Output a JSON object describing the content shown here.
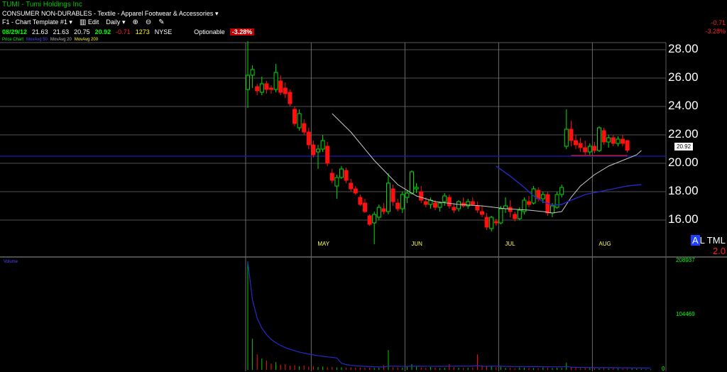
{
  "header": {
    "ticker": "TUMI",
    "company": "Tumi Holdings Inc",
    "sector": "CONSUMER NON-DURABLES",
    "industry": "Textile - Apparel Footwear & Accessories",
    "template": "F1 - Chart Template #1",
    "edit_label": "Edit",
    "period": "Daily"
  },
  "quote": {
    "date": "08/29/12",
    "open": "21.63",
    "high": "21.63",
    "low": "20.75",
    "close": "20.92",
    "change": "-0.71",
    "volume": "1273",
    "exchange": "NYSE",
    "optionable": "Optionable",
    "pct_change": "-3.28%"
  },
  "legend": {
    "price": "Price Chart",
    "ma50": "MovAvg 50",
    "ma20": "MovAvg 20",
    "ma200": "MovAvg 200"
  },
  "right_panel": {
    "change": "-0.71",
    "pct": "-3.28%",
    "last_price": "20.92",
    "indicator_a": "A",
    "indicator_text": "L TML",
    "indicator_value": "2.0"
  },
  "colors": {
    "up": "#00e000",
    "down": "#ff1010",
    "ma50": "#2828c8",
    "ma20": "#c8c8c8",
    "hline": "#1e1eb4"
  },
  "chart_data": {
    "type": "candlestick",
    "price_axis": {
      "ylim": [
        14.0,
        29.0
      ],
      "ticks": [
        "28.00",
        "26.00",
        "24.00",
        "22.00",
        "20.00",
        "18.00",
        "16.00"
      ],
      "tick_values": [
        28,
        26,
        24,
        22,
        20,
        18,
        16
      ]
    },
    "months": [
      "MAY",
      "JUN",
      "JUL",
      "AUG"
    ],
    "month_day_index": [
      14,
      34,
      54,
      74
    ],
    "num_days": 88,
    "reference_line": 20.5,
    "candles": [
      {
        "o": 25.2,
        "h": 28.6,
        "l": 23.9,
        "c": 26.2
      },
      {
        "o": 26.2,
        "h": 26.9,
        "l": 25.3,
        "c": 26.6
      },
      {
        "o": 25.4,
        "h": 25.6,
        "l": 24.8,
        "c": 25.1
      },
      {
        "o": 25.0,
        "h": 26.1,
        "l": 24.8,
        "c": 25.6
      },
      {
        "o": 25.6,
        "h": 25.8,
        "l": 24.9,
        "c": 25.2
      },
      {
        "o": 25.3,
        "h": 25.5,
        "l": 24.9,
        "c": 25.2
      },
      {
        "o": 25.2,
        "h": 27.0,
        "l": 25.0,
        "c": 26.4
      },
      {
        "o": 25.8,
        "h": 26.2,
        "l": 24.8,
        "c": 25.0
      },
      {
        "o": 25.3,
        "h": 25.7,
        "l": 24.6,
        "c": 24.9
      },
      {
        "o": 25.0,
        "h": 25.2,
        "l": 24.0,
        "c": 24.2
      },
      {
        "o": 23.8,
        "h": 24.0,
        "l": 22.6,
        "c": 22.8
      },
      {
        "o": 22.5,
        "h": 23.8,
        "l": 22.3,
        "c": 23.5
      },
      {
        "o": 22.8,
        "h": 23.1,
        "l": 22.0,
        "c": 22.2
      },
      {
        "o": 22.2,
        "h": 22.5,
        "l": 21.0,
        "c": 21.3
      },
      {
        "o": 21.3,
        "h": 21.6,
        "l": 20.4,
        "c": 20.6
      },
      {
        "o": 20.8,
        "h": 21.3,
        "l": 19.6,
        "c": 21.0
      },
      {
        "o": 21.0,
        "h": 22.0,
        "l": 20.8,
        "c": 21.6
      },
      {
        "o": 21.2,
        "h": 21.5,
        "l": 19.8,
        "c": 20.0
      },
      {
        "o": 19.3,
        "h": 19.6,
        "l": 18.6,
        "c": 18.8
      },
      {
        "o": 18.4,
        "h": 19.2,
        "l": 17.5,
        "c": 19.0
      },
      {
        "o": 19.0,
        "h": 19.8,
        "l": 18.9,
        "c": 19.6
      },
      {
        "o": 19.5,
        "h": 19.7,
        "l": 18.6,
        "c": 18.8
      },
      {
        "o": 18.6,
        "h": 18.9,
        "l": 18.0,
        "c": 18.2
      },
      {
        "o": 18.2,
        "h": 18.4,
        "l": 17.8,
        "c": 17.9
      },
      {
        "o": 17.6,
        "h": 17.8,
        "l": 17.0,
        "c": 17.1
      },
      {
        "o": 17.2,
        "h": 17.5,
        "l": 16.5,
        "c": 16.6
      },
      {
        "o": 16.3,
        "h": 16.4,
        "l": 15.6,
        "c": 15.7
      },
      {
        "o": 15.8,
        "h": 16.6,
        "l": 14.3,
        "c": 16.4
      },
      {
        "o": 16.2,
        "h": 17.1,
        "l": 16.0,
        "c": 16.9
      },
      {
        "o": 16.8,
        "h": 17.2,
        "l": 16.4,
        "c": 16.6
      },
      {
        "o": 16.6,
        "h": 19.3,
        "l": 16.4,
        "c": 18.6
      },
      {
        "o": 18.2,
        "h": 18.5,
        "l": 17.0,
        "c": 17.3
      },
      {
        "o": 17.2,
        "h": 17.5,
        "l": 16.6,
        "c": 16.8
      },
      {
        "o": 16.8,
        "h": 18.0,
        "l": 16.5,
        "c": 17.8
      },
      {
        "o": 17.6,
        "h": 18.1,
        "l": 17.2,
        "c": 17.9
      },
      {
        "o": 17.9,
        "h": 19.5,
        "l": 17.8,
        "c": 19.4
      },
      {
        "o": 18.2,
        "h": 18.6,
        "l": 17.9,
        "c": 18.3
      },
      {
        "o": 18.0,
        "h": 18.4,
        "l": 17.2,
        "c": 17.4
      },
      {
        "o": 17.3,
        "h": 17.6,
        "l": 16.9,
        "c": 17.1
      },
      {
        "o": 17.1,
        "h": 17.6,
        "l": 16.8,
        "c": 17.4
      },
      {
        "o": 17.2,
        "h": 17.4,
        "l": 16.7,
        "c": 16.9
      },
      {
        "o": 16.9,
        "h": 17.3,
        "l": 16.6,
        "c": 17.2
      },
      {
        "o": 17.3,
        "h": 17.9,
        "l": 17.0,
        "c": 17.7
      },
      {
        "o": 17.6,
        "h": 17.8,
        "l": 16.8,
        "c": 17.0
      },
      {
        "o": 16.9,
        "h": 17.2,
        "l": 16.5,
        "c": 16.7
      },
      {
        "o": 16.8,
        "h": 17.4,
        "l": 16.6,
        "c": 17.3
      },
      {
        "o": 17.2,
        "h": 17.6,
        "l": 16.9,
        "c": 17.0
      },
      {
        "o": 17.0,
        "h": 17.5,
        "l": 16.8,
        "c": 17.3
      },
      {
        "o": 17.3,
        "h": 17.6,
        "l": 17.0,
        "c": 17.1
      },
      {
        "o": 17.0,
        "h": 17.3,
        "l": 16.5,
        "c": 16.7
      },
      {
        "o": 16.6,
        "h": 17.0,
        "l": 16.2,
        "c": 16.4
      },
      {
        "o": 16.2,
        "h": 16.5,
        "l": 15.3,
        "c": 15.5
      },
      {
        "o": 15.4,
        "h": 16.3,
        "l": 15.2,
        "c": 16.2
      },
      {
        "o": 15.9,
        "h": 16.1,
        "l": 15.6,
        "c": 15.8
      },
      {
        "o": 15.8,
        "h": 17.0,
        "l": 15.7,
        "c": 16.8
      },
      {
        "o": 16.8,
        "h": 17.6,
        "l": 16.5,
        "c": 17.0
      },
      {
        "o": 16.9,
        "h": 17.4,
        "l": 16.2,
        "c": 16.6
      },
      {
        "o": 16.4,
        "h": 16.6,
        "l": 15.9,
        "c": 16.1
      },
      {
        "o": 16.1,
        "h": 16.9,
        "l": 16.0,
        "c": 16.7
      },
      {
        "o": 16.6,
        "h": 17.6,
        "l": 16.4,
        "c": 17.4
      },
      {
        "o": 17.3,
        "h": 17.7,
        "l": 16.9,
        "c": 17.1
      },
      {
        "o": 17.2,
        "h": 18.4,
        "l": 17.1,
        "c": 18.2
      },
      {
        "o": 18.1,
        "h": 18.3,
        "l": 17.3,
        "c": 17.5
      },
      {
        "o": 17.5,
        "h": 18.0,
        "l": 17.2,
        "c": 17.8
      },
      {
        "o": 17.8,
        "h": 18.0,
        "l": 16.3,
        "c": 16.5
      },
      {
        "o": 16.5,
        "h": 17.2,
        "l": 16.2,
        "c": 17.0
      },
      {
        "o": 16.9,
        "h": 18.0,
        "l": 16.8,
        "c": 17.8
      },
      {
        "o": 17.8,
        "h": 18.5,
        "l": 17.6,
        "c": 18.3
      },
      {
        "o": 21.2,
        "h": 23.8,
        "l": 21.0,
        "c": 22.4
      },
      {
        "o": 22.4,
        "h": 23.0,
        "l": 21.2,
        "c": 21.6
      },
      {
        "o": 21.6,
        "h": 22.0,
        "l": 21.0,
        "c": 21.3
      },
      {
        "o": 21.4,
        "h": 21.8,
        "l": 20.8,
        "c": 21.1
      },
      {
        "o": 21.1,
        "h": 21.6,
        "l": 20.6,
        "c": 20.8
      },
      {
        "o": 20.8,
        "h": 21.4,
        "l": 20.6,
        "c": 21.2
      },
      {
        "o": 21.2,
        "h": 21.5,
        "l": 20.7,
        "c": 20.9
      },
      {
        "o": 20.9,
        "h": 22.6,
        "l": 20.8,
        "c": 22.5
      },
      {
        "o": 22.3,
        "h": 22.5,
        "l": 21.3,
        "c": 21.5
      },
      {
        "o": 21.5,
        "h": 22.0,
        "l": 21.1,
        "c": 21.8
      },
      {
        "o": 21.8,
        "h": 22.0,
        "l": 21.2,
        "c": 21.4
      },
      {
        "o": 21.4,
        "h": 21.9,
        "l": 21.2,
        "c": 21.7
      },
      {
        "o": 21.7,
        "h": 22.0,
        "l": 21.2,
        "c": 21.4
      },
      {
        "o": 21.6,
        "h": 21.63,
        "l": 20.75,
        "c": 20.92
      }
    ],
    "ma20": [
      {
        "i": 18,
        "v": 23.5
      },
      {
        "i": 22,
        "v": 22.2
      },
      {
        "i": 27,
        "v": 20.2
      },
      {
        "i": 32,
        "v": 18.5
      },
      {
        "i": 36,
        "v": 17.7
      },
      {
        "i": 40,
        "v": 17.3
      },
      {
        "i": 45,
        "v": 17.1
      },
      {
        "i": 50,
        "v": 17.0
      },
      {
        "i": 55,
        "v": 16.8
      },
      {
        "i": 60,
        "v": 16.7
      },
      {
        "i": 63,
        "v": 16.6
      },
      {
        "i": 65,
        "v": 16.5
      },
      {
        "i": 67,
        "v": 16.6
      },
      {
        "i": 69,
        "v": 17.6
      },
      {
        "i": 71,
        "v": 18.4
      },
      {
        "i": 74,
        "v": 19.2
      },
      {
        "i": 77,
        "v": 19.8
      },
      {
        "i": 80,
        "v": 20.2
      },
      {
        "i": 83,
        "v": 20.6
      },
      {
        "i": 84,
        "v": 20.9
      }
    ],
    "ma50": [
      {
        "i": 53,
        "v": 19.8
      },
      {
        "i": 56,
        "v": 19.1
      },
      {
        "i": 59,
        "v": 18.3
      },
      {
        "i": 61,
        "v": 17.7
      },
      {
        "i": 63,
        "v": 17.3
      },
      {
        "i": 65,
        "v": 17.05
      },
      {
        "i": 67,
        "v": 17.1
      },
      {
        "i": 69,
        "v": 17.4
      },
      {
        "i": 72,
        "v": 17.8
      },
      {
        "i": 75,
        "v": 18.0
      },
      {
        "i": 78,
        "v": 18.2
      },
      {
        "i": 81,
        "v": 18.4
      },
      {
        "i": 84,
        "v": 18.5
      }
    ],
    "volume_axis": {
      "ylim": [
        0,
        208937
      ],
      "ticks": [
        "208937",
        "104469",
        "0"
      ],
      "tick_values": [
        208937,
        104469,
        0
      ]
    },
    "volume": [
      208937,
      60000,
      30000,
      22000,
      18000,
      12000,
      15000,
      10000,
      11000,
      8000,
      9000,
      7000,
      8500,
      6000,
      7000,
      5500,
      6500,
      5000,
      6000,
      4800,
      5200,
      4500,
      5000,
      4200,
      4600,
      4000,
      4300,
      3800,
      4100,
      9000,
      38000,
      5000,
      4500,
      4200,
      7000,
      11000,
      6000,
      4500,
      4000,
      5500,
      4500,
      3500,
      4000,
      11000,
      5000,
      4200,
      3800,
      4000,
      4500,
      30000,
      9000,
      8000,
      6500,
      5000,
      5800,
      3800,
      3500,
      3000,
      4500,
      4200,
      3800,
      3500,
      3000,
      4500,
      4000,
      3500,
      4200,
      3800,
      14000,
      6000,
      3500,
      3000,
      3800,
      3500,
      3000,
      2800,
      3200,
      2600,
      3000,
      2800,
      2500,
      2200,
      2800,
      2500,
      2000,
      1500,
      1273
    ],
    "volume_ma_label": "Volume"
  }
}
